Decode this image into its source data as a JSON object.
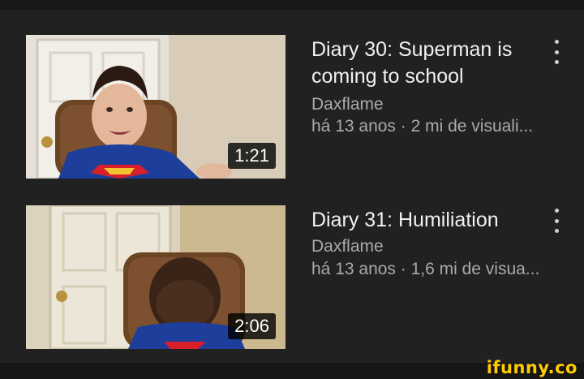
{
  "videos": [
    {
      "title": "Diary 30: Superman is coming to school",
      "channel": "Daxflame",
      "meta": "há 13 anos · 2 mi de visuali...",
      "duration": "1:21"
    },
    {
      "title": "Diary 31: Humiliation",
      "channel": "Daxflame",
      "meta": "há 13 anos · 1,6 mi de visua...",
      "duration": "2:06"
    }
  ],
  "watermark": "ifunny.co",
  "colors": {
    "background": "#212121",
    "title_text": "#f1f1f1",
    "secondary_text": "#aaaaaa",
    "watermark": "#ffcc00"
  },
  "icons": [
    "more-vert-icon"
  ]
}
